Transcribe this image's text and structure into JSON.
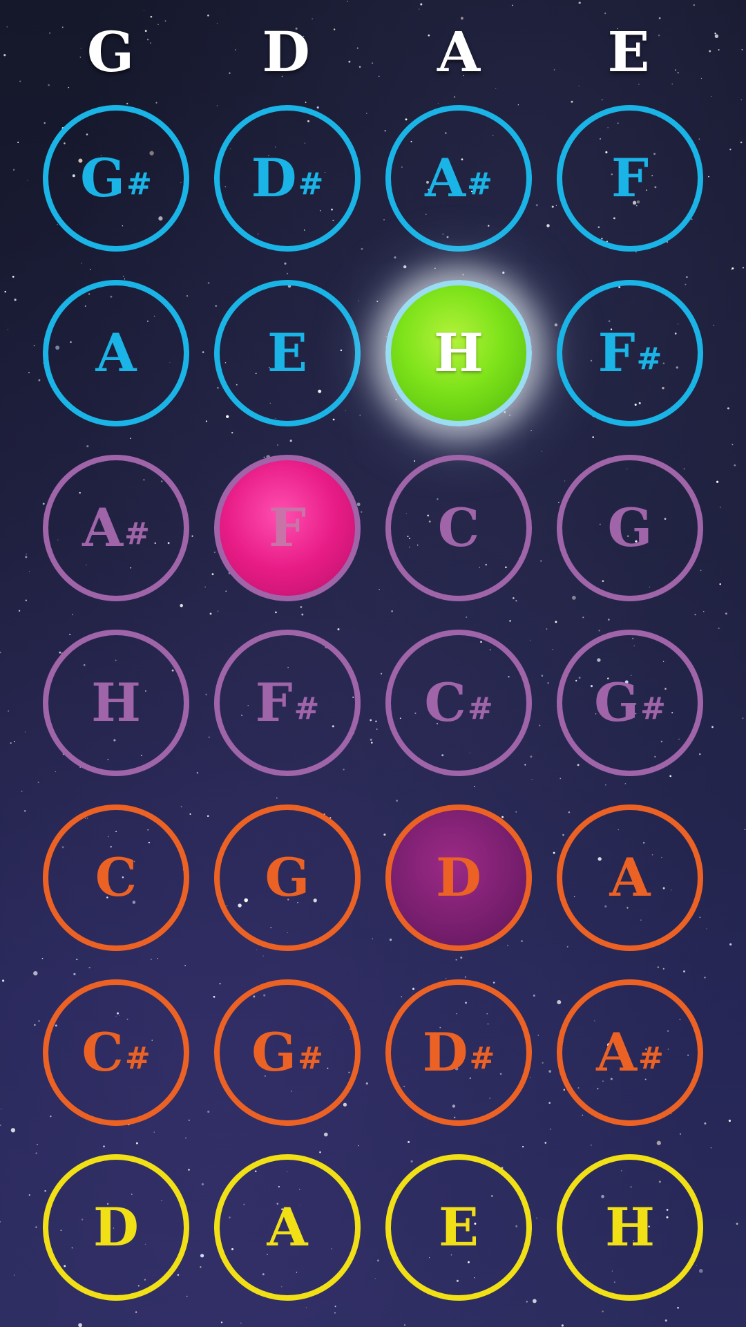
{
  "strings": [
    "G",
    "D",
    "A",
    "E"
  ],
  "rows": [
    {
      "color": "cyan",
      "notes": [
        {
          "name": "G",
          "sharp": "#"
        },
        {
          "name": "D",
          "sharp": "#"
        },
        {
          "name": "A",
          "sharp": "#"
        },
        {
          "name": "F",
          "sharp": ""
        }
      ]
    },
    {
      "color": "cyan",
      "notes": [
        {
          "name": "A",
          "sharp": ""
        },
        {
          "name": "E",
          "sharp": ""
        },
        {
          "name": "H",
          "sharp": "",
          "state": "active"
        },
        {
          "name": "F",
          "sharp": "#"
        }
      ]
    },
    {
      "color": "purple",
      "notes": [
        {
          "name": "A",
          "sharp": "#"
        },
        {
          "name": "F",
          "sharp": "",
          "state": "marked"
        },
        {
          "name": "C",
          "sharp": ""
        },
        {
          "name": "G",
          "sharp": ""
        }
      ]
    },
    {
      "color": "purple",
      "notes": [
        {
          "name": "H",
          "sharp": ""
        },
        {
          "name": "F",
          "sharp": "#"
        },
        {
          "name": "C",
          "sharp": "#"
        },
        {
          "name": "G",
          "sharp": "#"
        }
      ]
    },
    {
      "color": "orange",
      "notes": [
        {
          "name": "C",
          "sharp": ""
        },
        {
          "name": "G",
          "sharp": ""
        },
        {
          "name": "D",
          "sharp": "",
          "state": "marked-deep"
        },
        {
          "name": "A",
          "sharp": ""
        }
      ]
    },
    {
      "color": "orange",
      "notes": [
        {
          "name": "C",
          "sharp": "#"
        },
        {
          "name": "G",
          "sharp": "#"
        },
        {
          "name": "D",
          "sharp": "#"
        },
        {
          "name": "A",
          "sharp": "#"
        }
      ]
    },
    {
      "color": "yellow",
      "notes": [
        {
          "name": "D",
          "sharp": ""
        },
        {
          "name": "A",
          "sharp": ""
        },
        {
          "name": "E",
          "sharp": ""
        },
        {
          "name": "H",
          "sharp": ""
        }
      ]
    }
  ],
  "colors": {
    "cyan": "#1ab4e6",
    "purple": "#a064a8",
    "orange": "#ec6224",
    "yellow": "#f2e016",
    "active_fill": "#7ee31a",
    "marked_fill": "#e81c86"
  }
}
